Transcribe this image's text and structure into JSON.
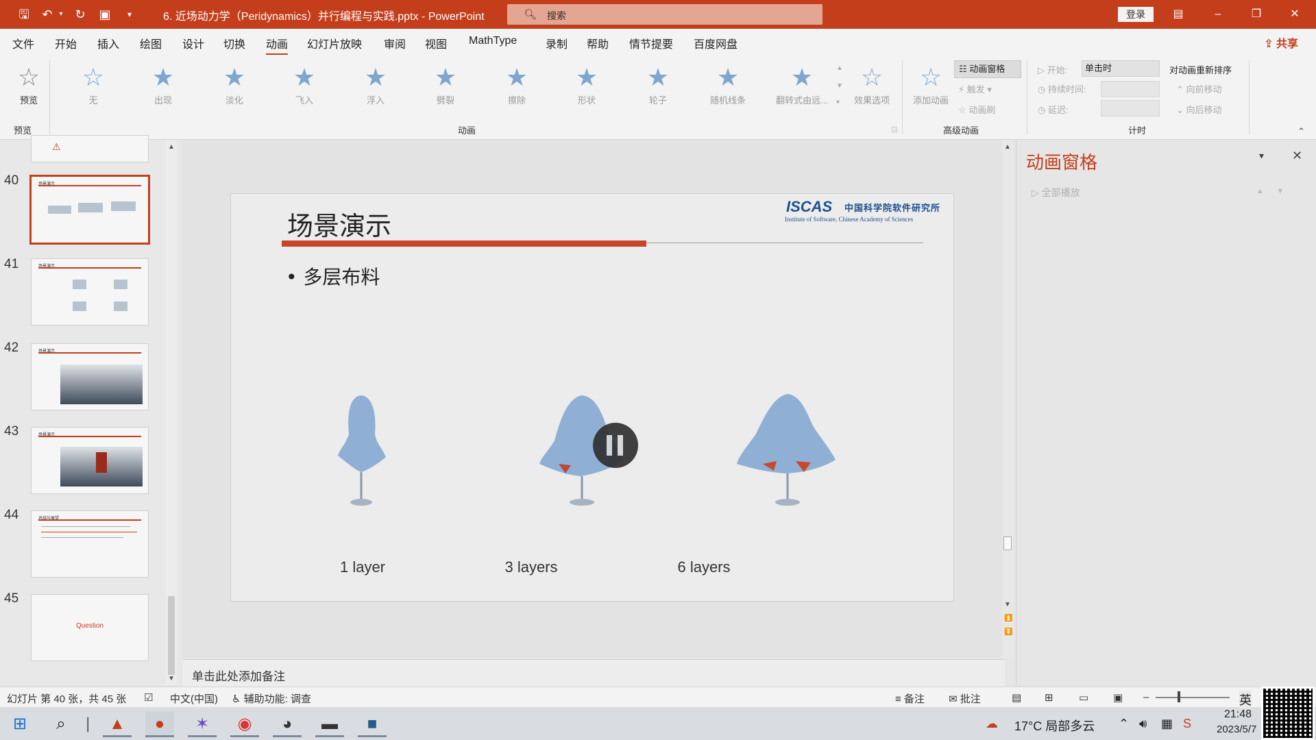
{
  "titlebar": {
    "doc_title": "6. 近场动力学（Peridynamics）并行编程与实践.pptx - PowerPoint",
    "search_placeholder": "搜索",
    "login_label": "登录",
    "accent_color": "#c43e1c"
  },
  "tabs": [
    "文件",
    "开始",
    "插入",
    "绘图",
    "设计",
    "切换",
    "动画",
    "幻灯片放映",
    "审阅",
    "视图",
    "MathType",
    "录制",
    "帮助",
    "情节提要",
    "百度网盘"
  ],
  "active_tab": "动画",
  "share_label": "共享",
  "ribbon": {
    "preview_label": "预览",
    "preview_group": "预览",
    "animations": [
      "无",
      "出现",
      "淡化",
      "飞入",
      "浮入",
      "劈裂",
      "擦除",
      "形状",
      "轮子",
      "随机线条",
      "翻转式由远...",
      "效果选项"
    ],
    "animation_group": "动画",
    "add_animation": "添加动画",
    "anim_pane_btn": "动画窗格",
    "trigger": "触发",
    "anim_painter": "动画刷",
    "advanced_group": "高级动画",
    "start_label": "开始:",
    "start_value": "单击时",
    "duration_label": "持续时间:",
    "delay_label": "延迟:",
    "reorder_label": "对动画重新排序",
    "move_earlier": "向前移动",
    "move_later": "向后移动",
    "timing_group": "计时"
  },
  "thumbnails": [
    {
      "num": "40",
      "title": "场景演示",
      "selected": true
    },
    {
      "num": "41",
      "title": "场景演示"
    },
    {
      "num": "42",
      "title": "场景演示"
    },
    {
      "num": "43",
      "title": "场景演示"
    },
    {
      "num": "44",
      "title": "总结与展望"
    },
    {
      "num": "45",
      "title": "Question"
    }
  ],
  "slide": {
    "title": "场景演示",
    "bullet": "• 多层布料",
    "logo_main": "ISCAS",
    "logo_cn": "中国科学院软件研究所",
    "logo_en": "Institute of Software, Chinese Academy of Sciences",
    "captions": [
      "1 layer",
      "3 layers",
      "6 layers"
    ]
  },
  "notes_placeholder": "单击此处添加备注",
  "anim_pane": {
    "title": "动画窗格",
    "play_all": "全部播放"
  },
  "status": {
    "slide_info": "幻灯片 第 40 张，共 45 张",
    "language": "中文(中国)",
    "accessibility": "辅助功能: 调查",
    "notes": "备注",
    "comments": "批注"
  },
  "taskbar": {
    "weather": "17°C  局部多云",
    "ime": "英",
    "time": "21:48",
    "date": "2023/5/7"
  }
}
